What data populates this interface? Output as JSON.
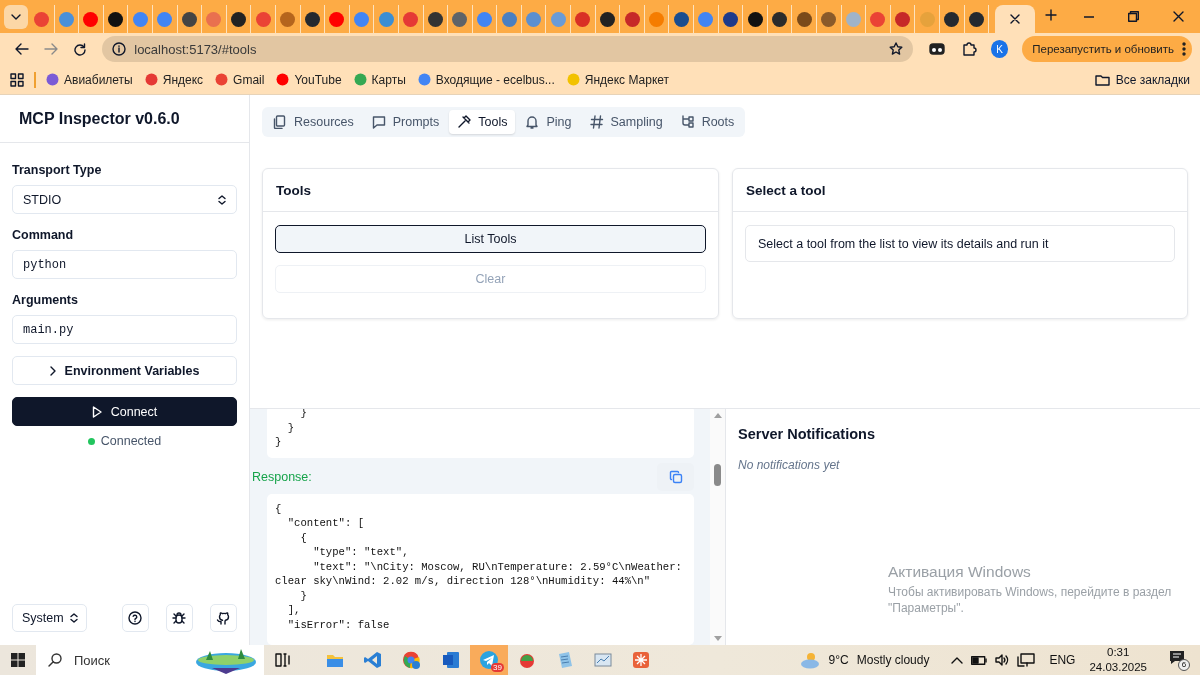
{
  "browser": {
    "tabs": [
      {
        "selected": false,
        "color": "#ea4335"
      },
      {
        "selected": false,
        "color": "#4a90d9"
      },
      {
        "selected": false,
        "color": "#ff0000"
      },
      {
        "selected": false,
        "color": "#111111"
      },
      {
        "selected": false,
        "color": "#4285f4"
      },
      {
        "selected": false,
        "color": "#4285f4"
      },
      {
        "selected": false,
        "color": "#444444"
      },
      {
        "selected": false,
        "color": "#e9704f"
      },
      {
        "selected": false,
        "color": "#222222"
      },
      {
        "selected": false,
        "color": "#ea4335"
      },
      {
        "selected": false,
        "color": "#b5651d"
      },
      {
        "selected": false,
        "color": "#24292f"
      },
      {
        "selected": false,
        "color": "#ff0000"
      },
      {
        "selected": false,
        "color": "#4285f4"
      },
      {
        "selected": false,
        "color": "#3b8ed4"
      },
      {
        "selected": false,
        "color": "#e53935"
      },
      {
        "selected": false,
        "color": "#333333"
      },
      {
        "selected": false,
        "color": "#5f6368"
      },
      {
        "selected": false,
        "color": "#4285f4"
      },
      {
        "selected": false,
        "color": "#4a7fc1"
      },
      {
        "selected": false,
        "color": "#5b8fd0"
      },
      {
        "selected": false,
        "color": "#6a9bd6"
      },
      {
        "selected": false,
        "color": "#d93025"
      },
      {
        "selected": false,
        "color": "#222222"
      },
      {
        "selected": false,
        "color": "#c62828"
      },
      {
        "selected": false,
        "color": "#f57c00"
      },
      {
        "selected": false,
        "color": "#1a4d8f"
      },
      {
        "selected": false,
        "color": "#4285f4"
      },
      {
        "selected": false,
        "color": "#1e3a8a"
      },
      {
        "selected": false,
        "color": "#111111"
      },
      {
        "selected": false,
        "color": "#2b2b2b"
      },
      {
        "selected": false,
        "color": "#7a4a1a"
      },
      {
        "selected": false,
        "color": "#8a5a2a"
      },
      {
        "selected": false,
        "color": "#9fb3c8"
      },
      {
        "selected": false,
        "color": "#ea4335"
      },
      {
        "selected": false,
        "color": "#c62828"
      },
      {
        "selected": false,
        "color": "#e6a23c"
      },
      {
        "selected": false,
        "color": "#24292f"
      },
      {
        "selected": false,
        "color": "#24292f"
      },
      {
        "selected": true
      }
    ],
    "address": "localhost:5173/#tools",
    "profile_initial": "K",
    "restart_button": "Перезапустить и обновить",
    "bookmarks": [
      "Авиабилеты",
      "Яндекс",
      "Gmail",
      "YouTube",
      "Карты",
      "Входящие - ecelbus...",
      "Яндекс Маркет"
    ],
    "all_bookmarks": "Все закладки"
  },
  "sidebar": {
    "title": "MCP Inspector v0.6.0",
    "transport_label": "Transport Type",
    "transport_value": "STDIO",
    "command_label": "Command",
    "command_value": "python",
    "arguments_label": "Arguments",
    "arguments_value": "main.py",
    "env_button": "Environment Variables",
    "connect_button": "Connect",
    "status": "Connected",
    "connected": true,
    "theme": "System"
  },
  "tabs": [
    {
      "label": "Resources",
      "selected": false
    },
    {
      "label": "Prompts",
      "selected": false
    },
    {
      "label": "Tools",
      "selected": true
    },
    {
      "label": "Ping",
      "selected": false
    },
    {
      "label": "Sampling",
      "selected": false
    },
    {
      "label": "Roots",
      "selected": false
    }
  ],
  "tools_panel": {
    "title": "Tools",
    "list_button": "List Tools",
    "clear_button": "Clear",
    "clear_disabled": true
  },
  "detail_panel": {
    "title": "Select a tool",
    "message": "Select a tool from the list to view its details and run it"
  },
  "history": {
    "request_tail": [
      "    }",
      "  }",
      "}"
    ],
    "response_label": "Response:",
    "response_lines": [
      "{",
      "  \"content\": [",
      "    {",
      "      \"type\": \"text\",",
      "      \"text\": \"\\nCity: Moscow, RU\\nTemperature: 2.59°C\\nWeather: clear sky\\nWind: 2.02 m/s, direction 128°\\nHumidity: 44%\\n\"",
      "    }",
      "  ],",
      "  \"isError\": false"
    ]
  },
  "notifications": {
    "title": "Server Notifications",
    "empty": "No notifications yet"
  },
  "activation": {
    "title": "Активация Windows",
    "text": "Чтобы активировать Windows, перейдите в раздел \"Параметры\"."
  },
  "taskbar": {
    "search_placeholder": "Поиск",
    "telegram_badge": "39",
    "temperature": "9°C",
    "condition": "Mostly cloudy",
    "language": "ENG",
    "time": "0:31",
    "date": "24.03.2025",
    "notification_count": "6"
  }
}
